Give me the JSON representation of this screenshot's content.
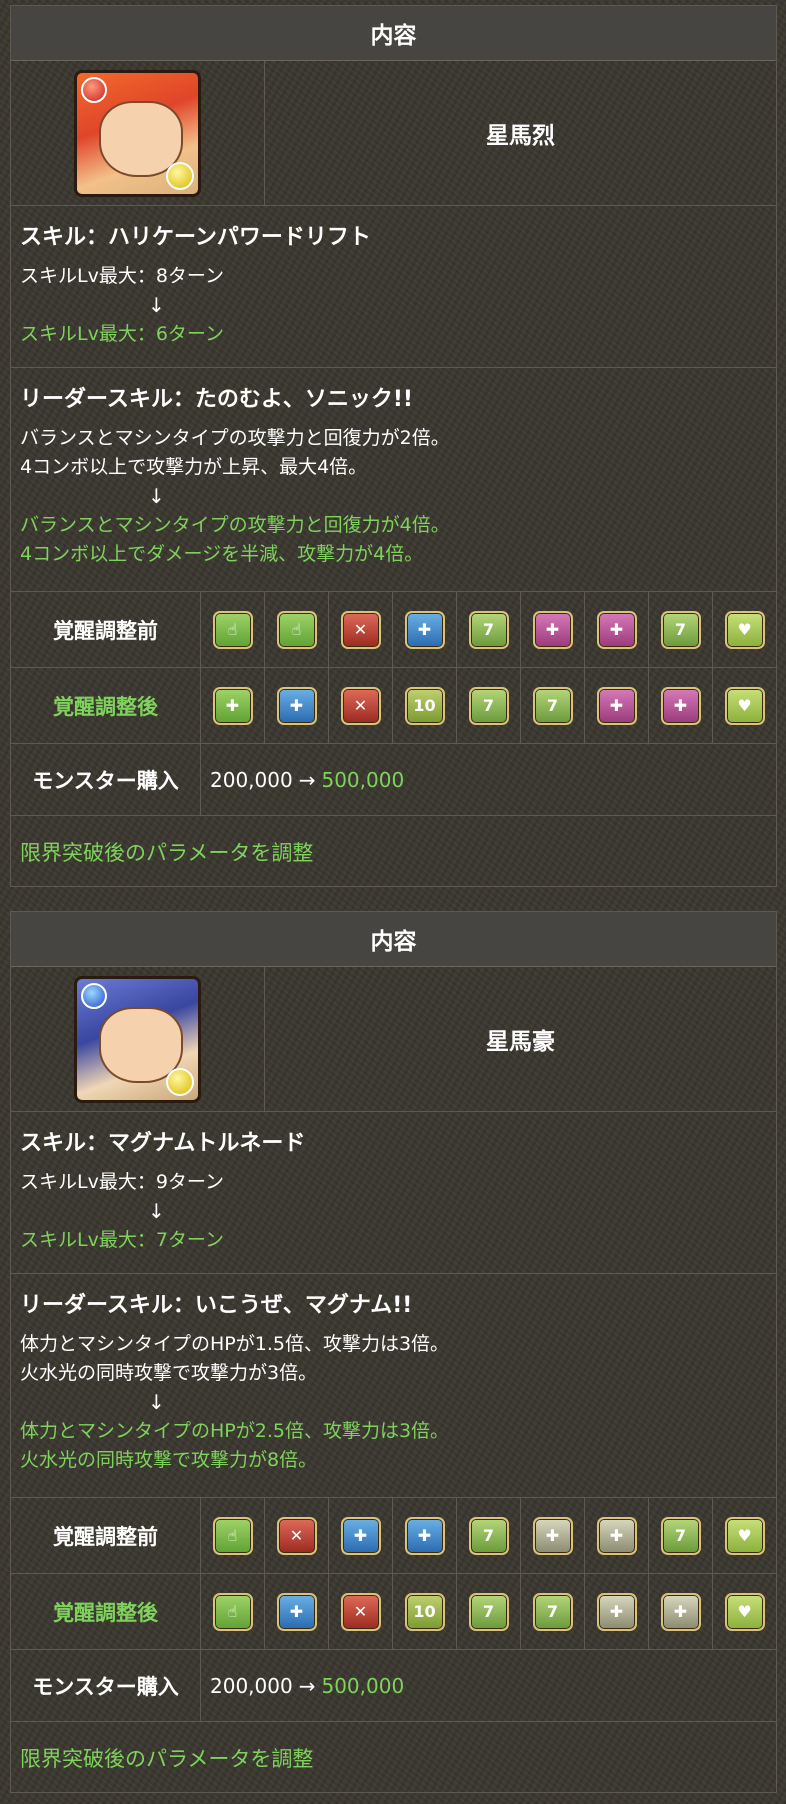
{
  "cards": [
    {
      "header": "内容",
      "monster_name": "星馬烈",
      "skill": {
        "title": "スキル：ハリケーンパワードリフト",
        "before": "スキルLv最大：8ターン",
        "arrow": "↓",
        "after": "スキルLv最大：6ターン"
      },
      "leader": {
        "title": "リーダースキル：たのむよ、ソニック!!",
        "before": [
          "バランスとマシンタイプの攻撃力と回復力が2倍。",
          "4コンボ以上で攻撃力が上昇、最大4倍。"
        ],
        "arrow": "↓",
        "after": [
          "バランスとマシンタイプの攻撃力と回復力が4倍。",
          "4コンボ以上でダメージを半減、攻撃力が4倍。"
        ]
      },
      "awaken_before_label": "覚醒調整前",
      "awaken_before": [
        "skill-boost-icon",
        "skill-boost-icon",
        "bind-resist-icon",
        "skill-boost-plus-icon",
        "seven-combo-icon",
        "team-skill-boost-icon",
        "team-skill-boost-icon",
        "seven-combo-icon",
        "heart-icon"
      ],
      "awaken_after_label": "覚醒調整後",
      "awaken_after": [
        "skill-boost-plus-icon",
        "skill-boost-plus-icon",
        "bind-resist-icon",
        "ten-combo-icon",
        "seven-combo-icon",
        "seven-combo-icon",
        "team-skill-boost-icon",
        "team-skill-boost-icon",
        "heart-icon"
      ],
      "buy_label": "モンスター購入",
      "buy_before": "200,000",
      "buy_arrow": "→",
      "buy_after": "500,000",
      "limit_note": "限界突破後のパラメータを調整"
    },
    {
      "header": "内容",
      "monster_name": "星馬豪",
      "skill": {
        "title": "スキル：マグナムトルネード",
        "before": "スキルLv最大：9ターン",
        "arrow": "↓",
        "after": "スキルLv最大：7ターン"
      },
      "leader": {
        "title": "リーダースキル：いこうぜ、マグナム!!",
        "before": [
          "体力とマシンタイプのHPが1.5倍、攻撃力は3倍。",
          "火水光の同時攻撃で攻撃力が3倍。"
        ],
        "arrow": "↓",
        "after": [
          "体力とマシンタイプのHPが2.5倍、攻撃力は3倍。",
          "火水光の同時攻撃で攻撃力が8倍。"
        ]
      },
      "awaken_before_label": "覚醒調整前",
      "awaken_before": [
        "skill-boost-icon",
        "bind-resist-icon",
        "skill-boost-plus-icon",
        "skill-boost-plus-icon",
        "seven-combo-icon",
        "team-skill-boost-icon",
        "team-skill-boost-icon",
        "seven-combo-icon",
        "heart-icon"
      ],
      "awaken_after_label": "覚醒調整後",
      "awaken_after": [
        "skill-boost-icon",
        "skill-boost-plus-icon",
        "bind-resist-icon",
        "ten-combo-icon",
        "seven-combo-icon",
        "seven-combo-icon",
        "team-skill-boost-icon",
        "team-skill-boost-icon",
        "heart-icon"
      ],
      "buy_label": "モンスター購入",
      "buy_before": "200,000",
      "buy_arrow": "→",
      "buy_after": "500,000",
      "limit_note": "限界突破後のパラメータを調整"
    }
  ],
  "colors": {
    "accent_green": "#7fd35c",
    "header_bg": "#474542",
    "border": "#5f5a50"
  }
}
